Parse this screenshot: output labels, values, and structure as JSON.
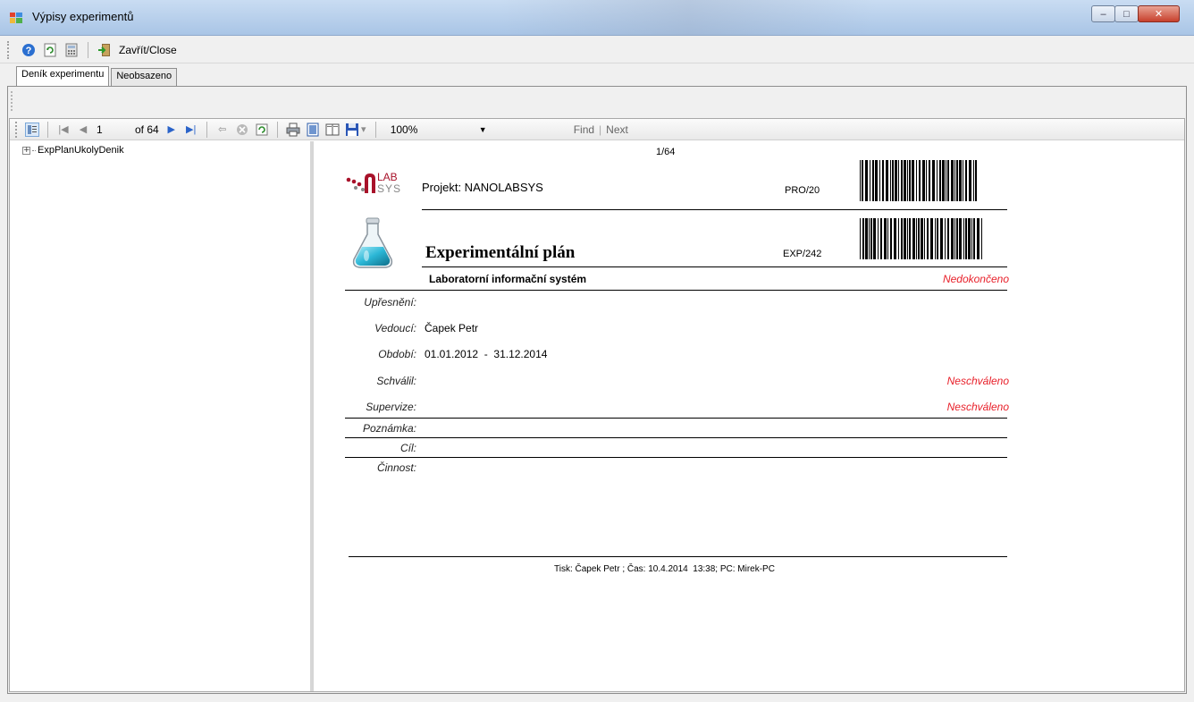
{
  "window": {
    "title": "Výpisy experimentů"
  },
  "toolbar": {
    "close_label": "Zavřít/Close"
  },
  "tabs": [
    {
      "label": "Deník experimentu",
      "active": true
    },
    {
      "label": "Neobsazeno",
      "active": false
    }
  ],
  "viewer_toolbar": {
    "current_page": "1",
    "page_of": "of 64",
    "zoom": "100%",
    "find_label": "Find",
    "next_label": "Next"
  },
  "tree": {
    "root_label": "ExpPlanUkolyDenik"
  },
  "report": {
    "page_indicator": "1/64",
    "project_label": "Projekt: NANOLABSYS",
    "project_code": "PRO/20",
    "title": "Experimentální plán",
    "experiment_code": "EXP/242",
    "subtitle": "Laboratorní informační systém",
    "status": "Nedokončeno",
    "fields": {
      "upresneni_label": "Upřesnění:",
      "vedouci_label": "Vedoucí:",
      "vedouci_value": "Čapek Petr",
      "obdobi_label": "Období:",
      "obdobi_value": "01.01.2012  -  31.12.2014",
      "schvalil_label": "Schválil:",
      "schvalil_status": "Neschváleno",
      "supervize_label": "Supervize:",
      "supervize_status": "Neschváleno",
      "poznamka_label": "Poznámka:",
      "cil_label": "Cíl:",
      "cinnost_label": "Činnost:"
    },
    "footer": "Tisk: Čapek Petr ; Čas: 10.4.2014  13:38; PC: Mirek-PC"
  },
  "colors": {
    "status_red": "#e8202a",
    "logo_red": "#a8122a",
    "flask_cyan": "#2bb7d6"
  }
}
